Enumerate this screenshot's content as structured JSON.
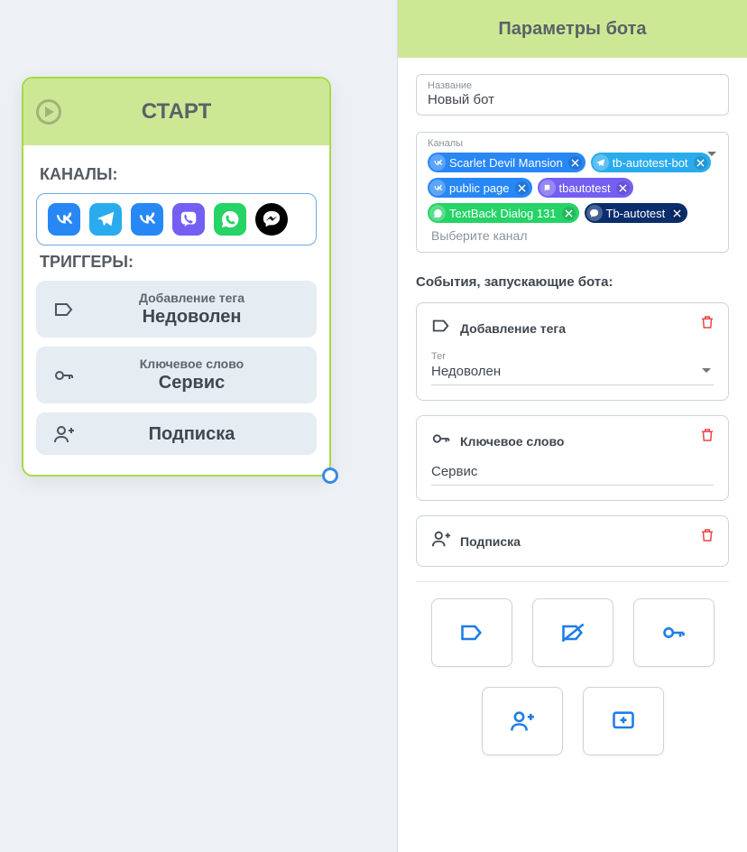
{
  "start_node": {
    "title": "СТАРТ",
    "channels_label": "КАНАЛЫ:",
    "triggers_label": "ТРИГГЕРЫ:",
    "triggers": [
      {
        "type_label": "Добавление тега",
        "value": "Недоволен",
        "icon": "tag"
      },
      {
        "type_label": "Ключевое слово",
        "value": "Сервис",
        "icon": "key"
      },
      {
        "type_label": "Подписка",
        "value": "",
        "icon": "subscriber"
      }
    ]
  },
  "panel": {
    "title": "Параметры бота",
    "name_field": {
      "label": "Название",
      "value": "Новый бот"
    },
    "channels_field": {
      "label": "Каналы",
      "placeholder": "Выберите канал",
      "chips": [
        {
          "name": "Scarlet Devil Mansion",
          "type": "vk"
        },
        {
          "name": "tb-autotest-bot",
          "type": "tg"
        },
        {
          "name": "public page",
          "type": "vk"
        },
        {
          "name": "tbautotest",
          "type": "vb"
        },
        {
          "name": "TextBack Dialog 131",
          "type": "wa"
        },
        {
          "name": "Tb-autotest",
          "type": "fb"
        }
      ]
    },
    "events_label": "События, запускающие бота:",
    "cards": {
      "tag": {
        "title": "Добавление тега",
        "field_label": "Тег",
        "value": "Недоволен"
      },
      "keyword": {
        "title": "Ключевое слово",
        "value": "Сервис"
      },
      "subscribe": {
        "title": "Подписка"
      }
    },
    "action_buttons": [
      "add-tag",
      "remove-tag",
      "keyword",
      "subscriber",
      "message"
    ]
  }
}
